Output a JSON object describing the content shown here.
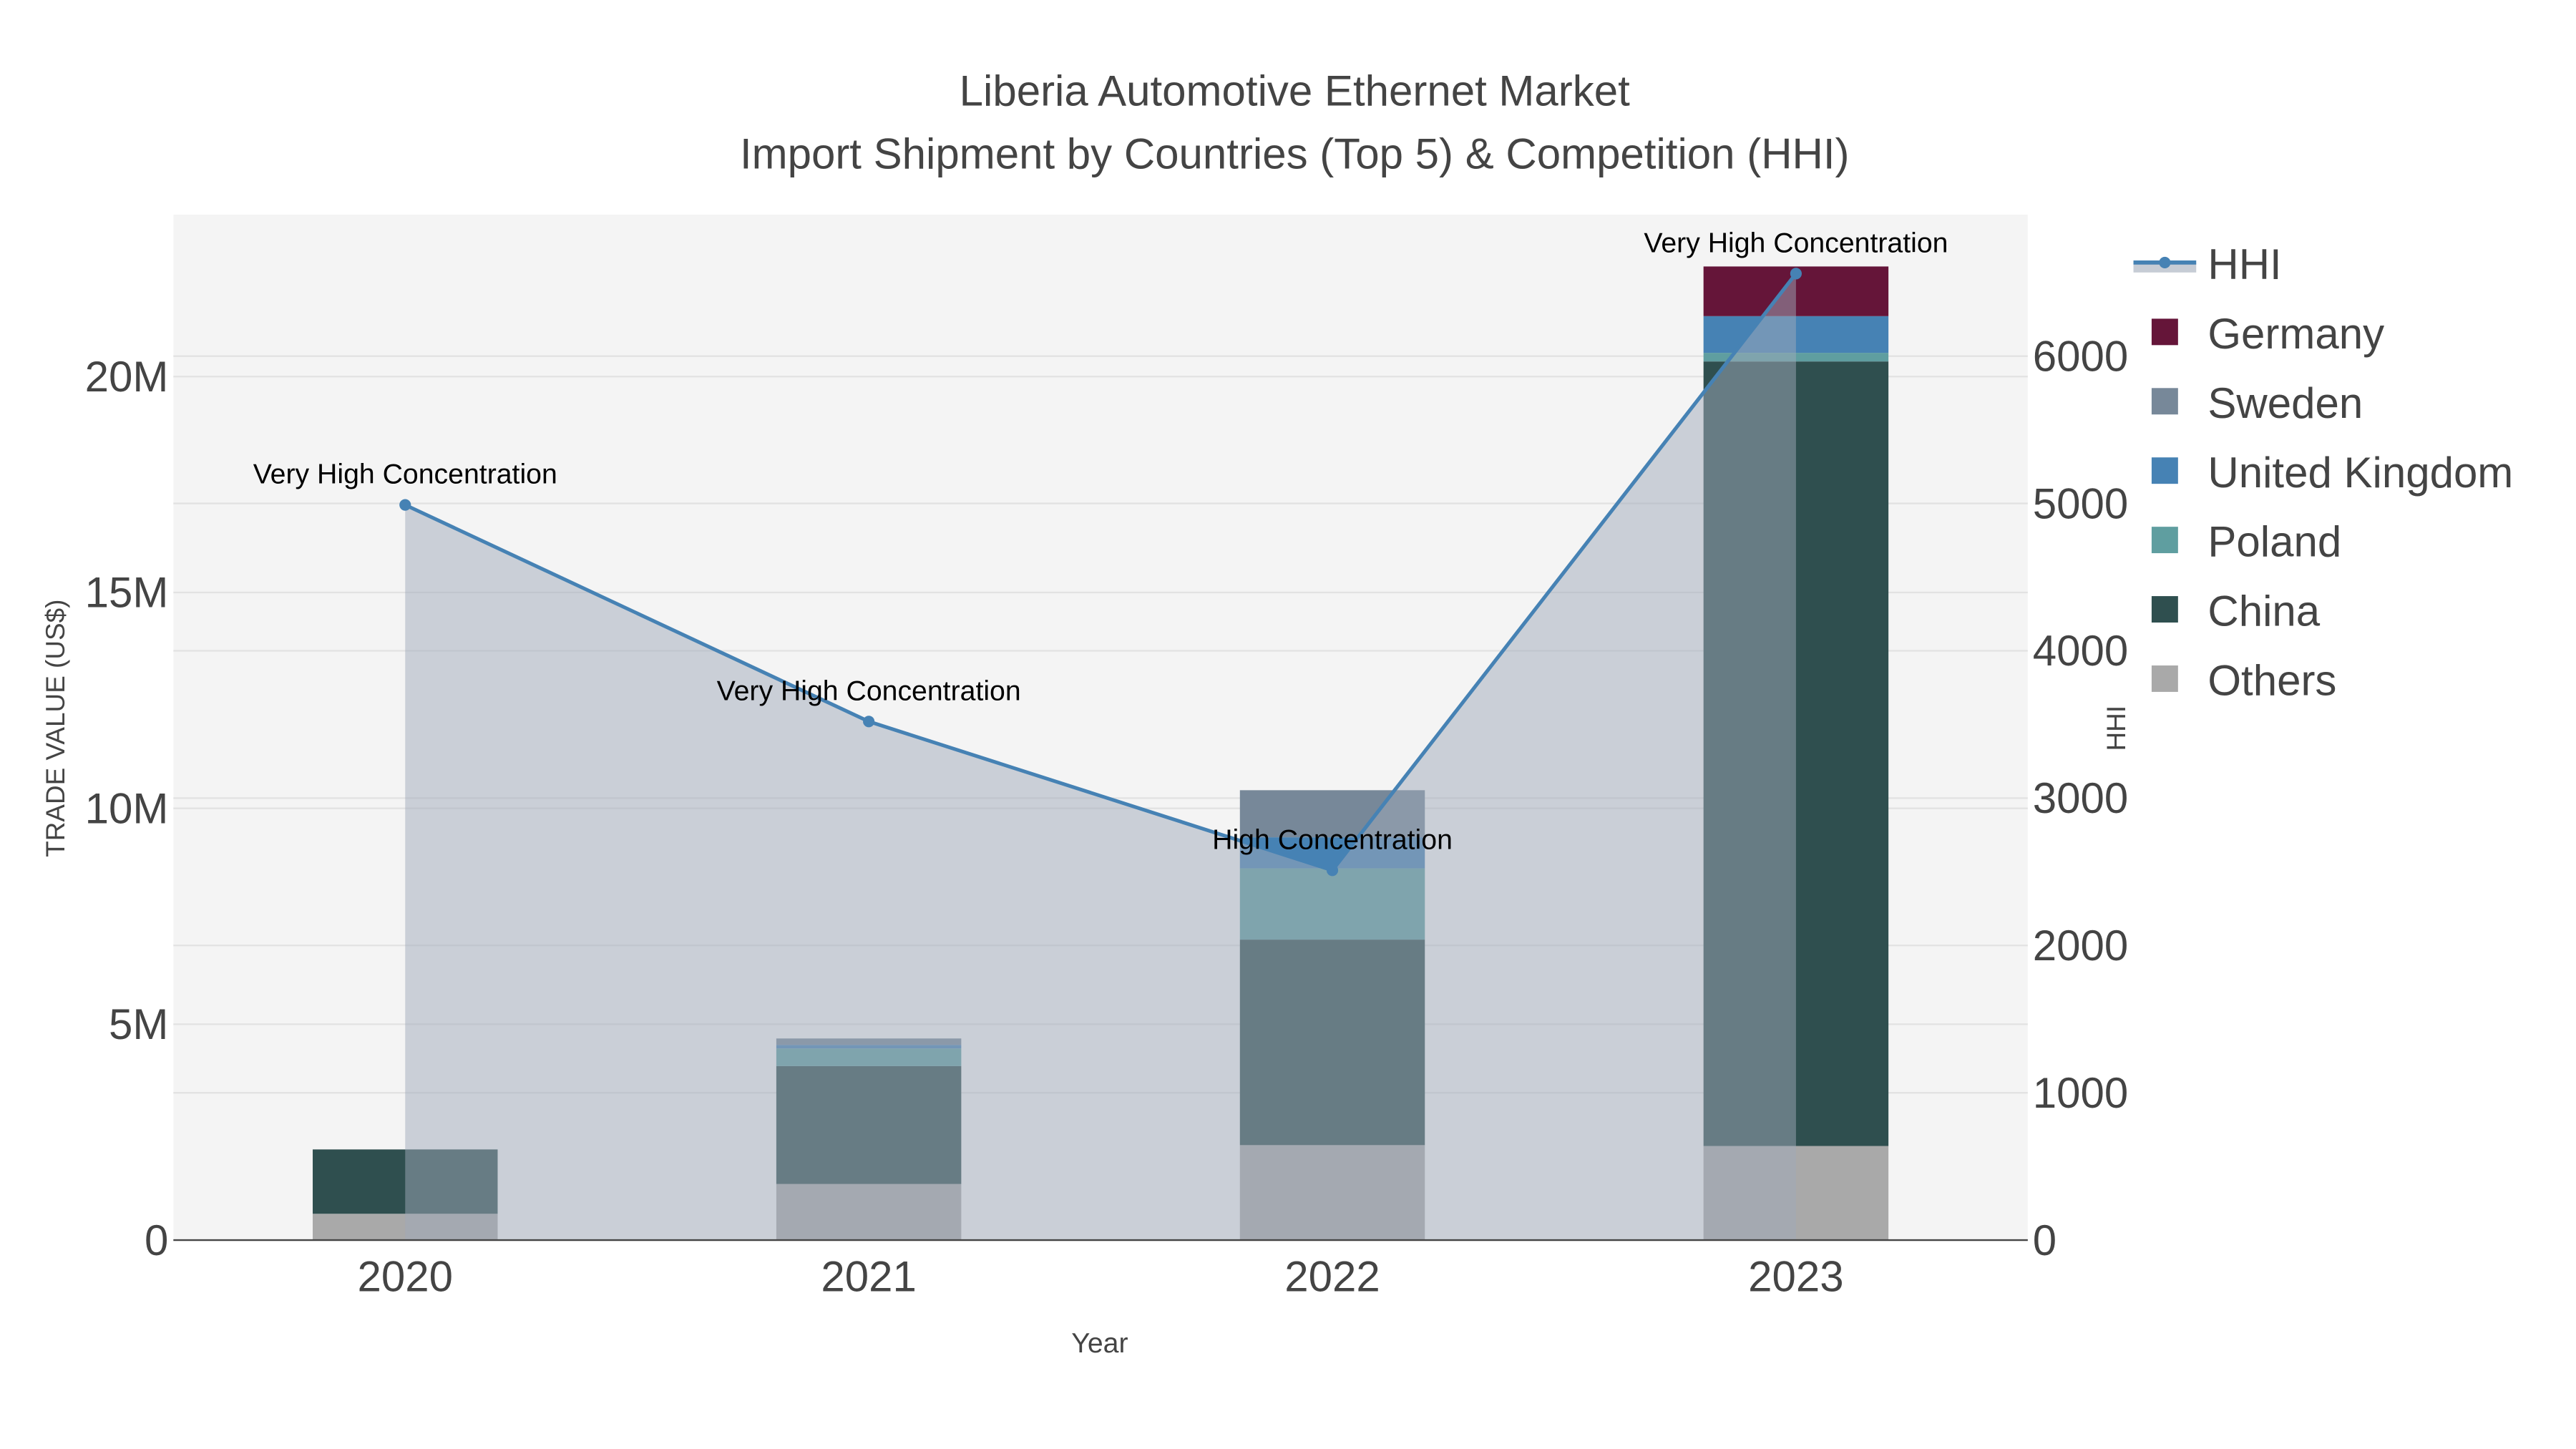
{
  "chart_data": {
    "type": "bar",
    "title_line1": "Liberia Automotive Ethernet Market",
    "title_line2": "Import Shipment by Countries (Top 5) & Competition (HHI)",
    "xlabel": "Year",
    "ylabel": "TRADE VALUE (US$)",
    "y2label": "HHI",
    "categories": [
      "2020",
      "2021",
      "2022",
      "2023"
    ],
    "ylim": [
      0,
      23750000
    ],
    "y2lim": [
      0,
      6960
    ],
    "yticks": [
      {
        "v": 0,
        "label": "0"
      },
      {
        "v": 5000000,
        "label": "5M"
      },
      {
        "v": 10000000,
        "label": "10M"
      },
      {
        "v": 15000000,
        "label": "15M"
      },
      {
        "v": 20000000,
        "label": "20M"
      }
    ],
    "y2ticks": [
      {
        "v": 0,
        "label": "0"
      },
      {
        "v": 1000,
        "label": "1000"
      },
      {
        "v": 2000,
        "label": "2000"
      },
      {
        "v": 3000,
        "label": "3000"
      },
      {
        "v": 4000,
        "label": "4000"
      },
      {
        "v": 5000,
        "label": "5000"
      },
      {
        "v": 6000,
        "label": "6000"
      }
    ],
    "series": [
      {
        "name": "Others",
        "color": "#a9a9a9",
        "values": [
          610000,
          1300000,
          2200000,
          2180000
        ]
      },
      {
        "name": "China",
        "color": "#2f4f4f",
        "values": [
          1490000,
          2730000,
          4760000,
          18170000
        ]
      },
      {
        "name": "Poland",
        "color": "#5f9ea0",
        "values": [
          0,
          410000,
          1650000,
          200000
        ]
      },
      {
        "name": "United Kingdom",
        "color": "#4682b4",
        "values": [
          0,
          80000,
          720000,
          850000
        ]
      },
      {
        "name": "Sweden",
        "color": "#778899",
        "values": [
          0,
          150000,
          1090000,
          0
        ]
      },
      {
        "name": "Germany",
        "color": "#651539",
        "values": [
          0,
          0,
          0,
          1150000
        ]
      }
    ],
    "hhi": {
      "name": "HHI",
      "color": "#4682b4",
      "values": [
        4990,
        3520,
        2510,
        6560
      ],
      "labels": [
        "Very High Concentration",
        "Very High Concentration",
        "High Concentration",
        "Very High Concentration"
      ]
    },
    "legend": [
      "HHI",
      "Germany",
      "Sweden",
      "United Kingdom",
      "Poland",
      "China",
      "Others"
    ],
    "legend_position": "right"
  }
}
